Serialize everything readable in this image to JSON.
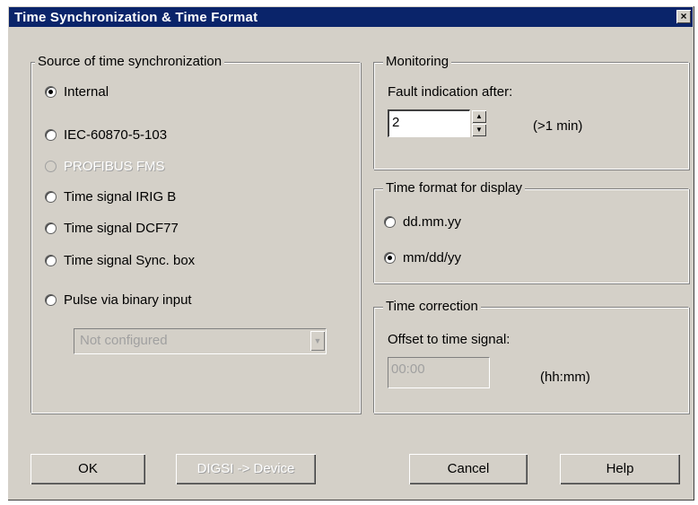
{
  "window": {
    "title": "Time Synchronization & Time Format",
    "close_glyph": "×"
  },
  "source_group": {
    "label": "Source of time synchronization",
    "options": [
      {
        "label": "Internal",
        "selected": true,
        "enabled": true
      },
      {
        "label": "IEC-60870-5-103",
        "selected": false,
        "enabled": true
      },
      {
        "label": "PROFIBUS FMS",
        "selected": false,
        "enabled": false
      },
      {
        "label": "Time signal IRIG B",
        "selected": false,
        "enabled": true
      },
      {
        "label": "Time signal DCF77",
        "selected": false,
        "enabled": true
      },
      {
        "label": "Time signal Sync. box",
        "selected": false,
        "enabled": true
      },
      {
        "label": "Pulse via binary input",
        "selected": false,
        "enabled": true
      }
    ],
    "binary_input_select": {
      "value": "Not configured",
      "enabled": false
    }
  },
  "monitoring_group": {
    "label": "Monitoring",
    "fault_label": "Fault indication after:",
    "fault_value": "2",
    "fault_unit": "(>1 min)"
  },
  "time_format_group": {
    "label": "Time format for display",
    "options": [
      {
        "label": "dd.mm.yy",
        "selected": false
      },
      {
        "label": "mm/dd/yy",
        "selected": true
      }
    ]
  },
  "time_correction_group": {
    "label": "Time correction",
    "offset_label": "Offset to time signal:",
    "offset_value": "00:00",
    "offset_unit": "(hh:mm)"
  },
  "buttons": {
    "ok": "OK",
    "digsi": "DIGSI -> Device",
    "cancel": "Cancel",
    "help": "Help"
  },
  "icons": {
    "spin_up": "▲",
    "spin_down": "▼",
    "combo_arrow": "▼"
  }
}
